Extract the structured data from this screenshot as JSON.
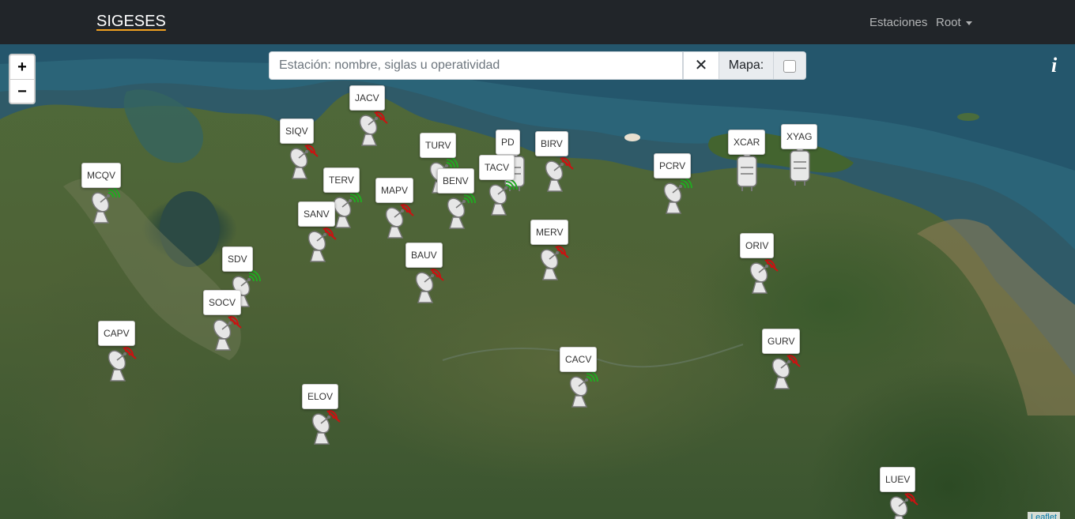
{
  "navbar": {
    "brand": "SIGESES",
    "estaciones": "Estaciones",
    "root": "Root"
  },
  "map": {
    "zoom_in": "+",
    "zoom_out": "−",
    "search_placeholder": "Estación: nombre, siglas u operatividad",
    "clear": "✕",
    "mapa_label": "Mapa:",
    "info": "i",
    "attribution": "Leaflet"
  },
  "stations": [
    {
      "name": "MCQV",
      "status": "online",
      "icon": "antenna-icon"
    },
    {
      "name": "SIQV",
      "status": "offline",
      "icon": "antenna-icon"
    },
    {
      "name": "JACV",
      "status": "offline",
      "icon": "antenna-icon"
    },
    {
      "name": "TERV",
      "status": "online",
      "icon": "antenna-icon"
    },
    {
      "name": "SANV",
      "status": "offline",
      "icon": "antenna-icon"
    },
    {
      "name": "MAPV",
      "status": "offline",
      "icon": "antenna-icon"
    },
    {
      "name": "TURV",
      "status": "online",
      "icon": "antenna-icon"
    },
    {
      "name": "BENV",
      "status": "online",
      "icon": "antenna-icon"
    },
    {
      "name": "PD",
      "status": "device",
      "icon": "device-icon"
    },
    {
      "name": "TACV",
      "status": "online",
      "icon": "antenna-icon"
    },
    {
      "name": "BIRV",
      "status": "offline",
      "icon": "antenna-icon"
    },
    {
      "name": "PCRV",
      "status": "online",
      "icon": "antenna-icon"
    },
    {
      "name": "XCAR",
      "status": "device",
      "icon": "device-icon"
    },
    {
      "name": "XYAG",
      "status": "device",
      "icon": "device-icon"
    },
    {
      "name": "SDV",
      "status": "online",
      "icon": "antenna-icon"
    },
    {
      "name": "SOCV",
      "status": "offline",
      "icon": "antenna-icon"
    },
    {
      "name": "BAUV",
      "status": "offline",
      "icon": "antenna-icon"
    },
    {
      "name": "MERV",
      "status": "offline",
      "icon": "antenna-icon"
    },
    {
      "name": "ORIV",
      "status": "offline",
      "icon": "antenna-icon"
    },
    {
      "name": "CAPV",
      "status": "offline",
      "icon": "antenna-icon"
    },
    {
      "name": "GURV",
      "status": "offline",
      "icon": "antenna-icon"
    },
    {
      "name": "CACV",
      "status": "online",
      "icon": "antenna-icon"
    },
    {
      "name": "ELOV",
      "status": "offline",
      "icon": "antenna-icon"
    },
    {
      "name": "LUEV",
      "status": "offline",
      "icon": "antenna-icon"
    }
  ],
  "colors": {
    "online": "#22aa22",
    "offline": "#cc1111",
    "navbar": "#212529"
  }
}
